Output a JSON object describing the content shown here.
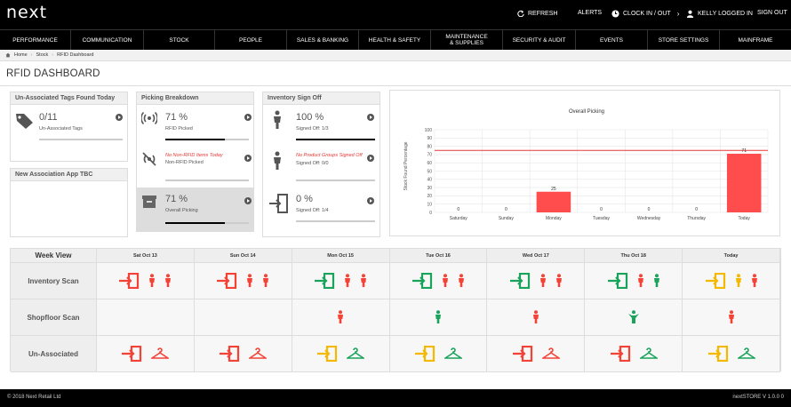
{
  "header": {
    "logo": "next",
    "actions": [
      {
        "label": "REFRESH",
        "icon": "refresh-icon"
      },
      {
        "label": "ALERTS",
        "icon": ""
      },
      {
        "label": "CLOCK IN / OUT",
        "icon": "clock-icon"
      },
      {
        "label": "KELLY LOGGED IN",
        "icon": "user-icon"
      },
      {
        "label": "SIGN OUT",
        "icon": ""
      }
    ]
  },
  "nav": [
    "PERFORMANCE",
    "COMMUNICATION",
    "STOCK",
    "PEOPLE",
    "SALES & BANKING",
    "HEALTH & SAFETY",
    "MAINTENANCE & SUPPLIES",
    "SECURITY & AUDIT",
    "EVENTS",
    "STORE SETTINGS",
    "MAINFRAME"
  ],
  "breadcrumb": [
    "Home",
    "Stock",
    "RFID Dashboard"
  ],
  "page_title": "RFID DASHBOARD",
  "unassociated": {
    "title": "Un-Associated Tags Found Today",
    "value": "0/11",
    "label": "Un-Associated Tags",
    "progress": 0
  },
  "new_assoc": {
    "title": "New Association App TBC"
  },
  "picking": {
    "title": "Picking Breakdown",
    "rfid": {
      "value": "71 %",
      "label": "RFID Picked",
      "progress": 0.71
    },
    "non_rfid": {
      "value": "No Non-RFID Items Today",
      "label": "Non-RFID Picked",
      "progress": 0
    },
    "overall": {
      "value": "71 %",
      "label": "Overall Picking",
      "progress": 0.71
    }
  },
  "signoff": {
    "title": "Inventory Sign Off",
    "signed": {
      "value": "100 %",
      "label": "Signed Off: 1/3",
      "progress": 1.0
    },
    "groups": {
      "value": "No Product Groups Signed Off",
      "label": "Signed Off: 0/0",
      "progress": 0
    },
    "percent": {
      "value": "0 %",
      "label": "Signed Off: 1/4",
      "progress": 0
    }
  },
  "chart_data": {
    "type": "bar",
    "title": "Overall Picking",
    "ylabel": "Stock Found Percentage",
    "xlabel": "",
    "categories": [
      "Saturday",
      "Sunday",
      "Monday",
      "Tuesday",
      "Wednesday",
      "Thursday",
      "Today"
    ],
    "values": [
      0,
      0,
      25,
      0,
      0,
      0,
      71
    ],
    "ylim": [
      0,
      100
    ],
    "yticks": [
      0,
      10,
      20,
      30,
      40,
      50,
      60,
      70,
      80,
      90,
      100
    ],
    "target_line": 75,
    "bar_color": "#ff4d4d",
    "line_color": "#e53935",
    "grid": true
  },
  "week_view": {
    "title": "Week View",
    "days": [
      "Sat Oct 13",
      "Sun Oct 14",
      "Mon Oct 15",
      "Tue Oct 16",
      "Wed Oct 17",
      "Thu Oct 18",
      "Today"
    ],
    "rows": [
      {
        "label": "Inventory Scan",
        "cells": [
          [
            [
              "door-icon",
              "red"
            ],
            [
              "person-icon",
              "red"
            ],
            [
              "person-icon",
              "red"
            ]
          ],
          [
            [
              "door-icon",
              "red"
            ],
            [
              "person-icon",
              "red"
            ],
            [
              "person-icon",
              "red"
            ]
          ],
          [
            [
              "door-icon",
              "green"
            ],
            [
              "person-icon",
              "red"
            ],
            [
              "person-icon",
              "red"
            ]
          ],
          [
            [
              "door-icon",
              "green"
            ],
            [
              "person-icon",
              "red"
            ],
            [
              "person-icon",
              "red"
            ]
          ],
          [
            [
              "door-icon",
              "green"
            ],
            [
              "person-icon",
              "red"
            ],
            [
              "person-icon",
              "red"
            ]
          ],
          [
            [
              "door-icon",
              "green"
            ],
            [
              "person-icon",
              "red"
            ],
            [
              "person-icon",
              "green"
            ]
          ],
          [
            [
              "door-icon",
              "yellow"
            ],
            [
              "person-icon",
              "yellow"
            ],
            [
              "person-icon",
              "red"
            ]
          ]
        ]
      },
      {
        "label": "Shopfloor Scan",
        "cells": [
          [],
          [],
          [
            [
              "person-icon",
              "red"
            ]
          ],
          [
            [
              "person-icon",
              "green"
            ]
          ],
          [
            [
              "person-icon",
              "red"
            ]
          ],
          [
            [
              "star-person-icon",
              "green"
            ]
          ],
          [
            [
              "person-icon",
              "red"
            ]
          ]
        ]
      },
      {
        "label": "Un-Associated",
        "cells": [
          [
            [
              "door-icon",
              "red"
            ],
            [
              "hanger-icon",
              "red"
            ]
          ],
          [
            [
              "door-icon",
              "red"
            ],
            [
              "hanger-icon",
              "red"
            ]
          ],
          [
            [
              "door-icon",
              "yellow"
            ],
            [
              "hanger-icon",
              "green"
            ]
          ],
          [
            [
              "door-icon",
              "yellow"
            ],
            [
              "hanger-icon",
              "green"
            ]
          ],
          [
            [
              "door-icon",
              "red"
            ],
            [
              "hanger-icon",
              "red"
            ]
          ],
          [
            [
              "door-icon",
              "red"
            ],
            [
              "hanger-icon",
              "green"
            ]
          ],
          [
            [
              "door-icon",
              "yellow"
            ],
            [
              "hanger-icon",
              "green"
            ]
          ]
        ]
      }
    ]
  },
  "colors": {
    "red": "#f44336",
    "green": "#1aa35b",
    "yellow": "#f5b800",
    "dark": "#000000"
  },
  "footer": {
    "copyright": "© 2018 Next Retail Ltd",
    "version": "nextSTORE V 1.0.0 0"
  }
}
